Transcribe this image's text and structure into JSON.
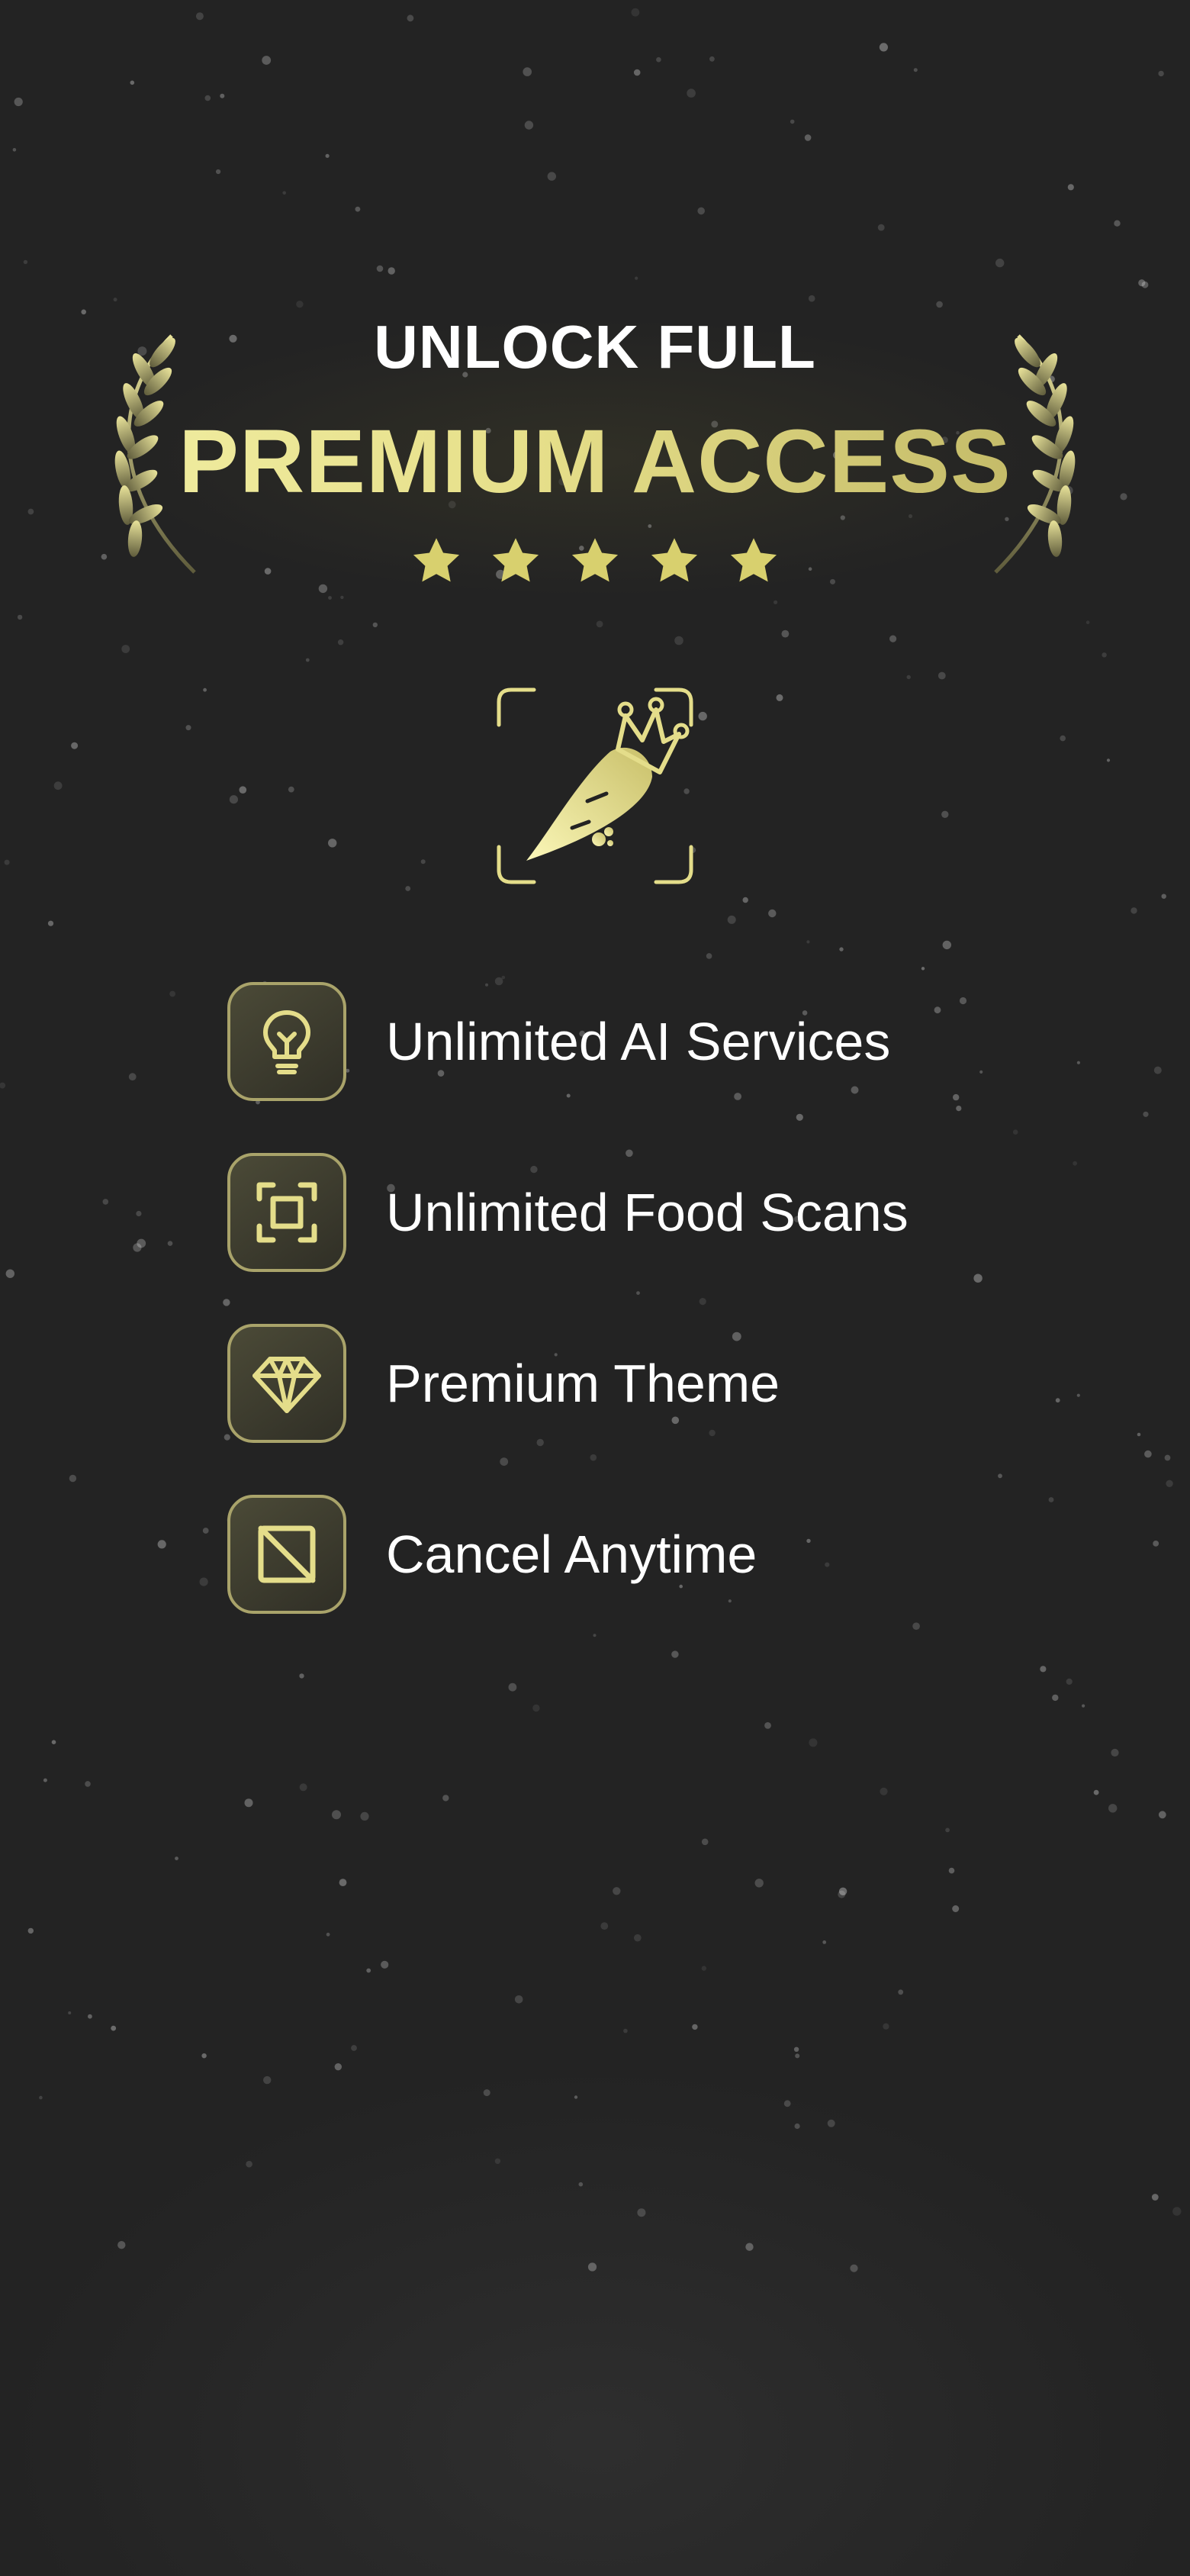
{
  "header": {
    "line1": "UNLOCK FULL",
    "line2": "PREMIUM ACCESS",
    "rating_stars": 5,
    "accent_color": "#e6df8a"
  },
  "logo": {
    "icon": "crowned-carrot-icon"
  },
  "features": [
    {
      "icon": "lightbulb-icon",
      "label": "Unlimited AI Services"
    },
    {
      "icon": "scan-frame-icon",
      "label": "Unlimited Food Scans"
    },
    {
      "icon": "diamond-icon",
      "label": "Premium Theme"
    },
    {
      "icon": "cancel-square-icon",
      "label": "Cancel Anytime"
    }
  ],
  "colors": {
    "background": "#232323",
    "gold_light": "#f3f0a6",
    "gold_dark": "#b8ae5c",
    "text": "#ffffff"
  }
}
